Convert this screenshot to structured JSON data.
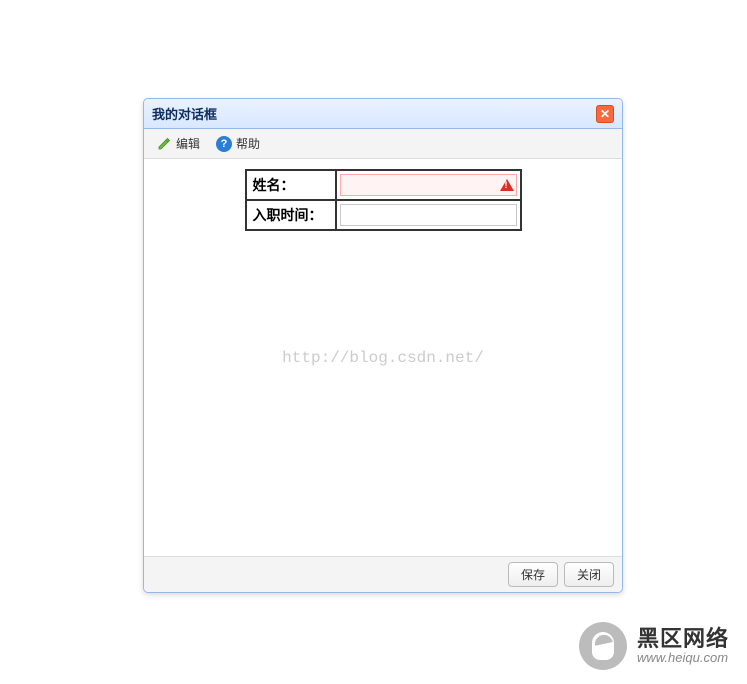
{
  "dialog": {
    "title": "我的对话框",
    "toolbar": {
      "edit_label": "编辑",
      "help_label": "帮助"
    },
    "form": {
      "name_label": "姓名：",
      "name_value": "",
      "hire_date_label": "入职时间：",
      "hire_date_value": ""
    },
    "watermark": "http://blog.csdn.net/",
    "footer": {
      "save_label": "保存",
      "close_label": "关闭"
    }
  },
  "brand": {
    "title": "黑区网络",
    "url": "www.heiqu.com"
  }
}
